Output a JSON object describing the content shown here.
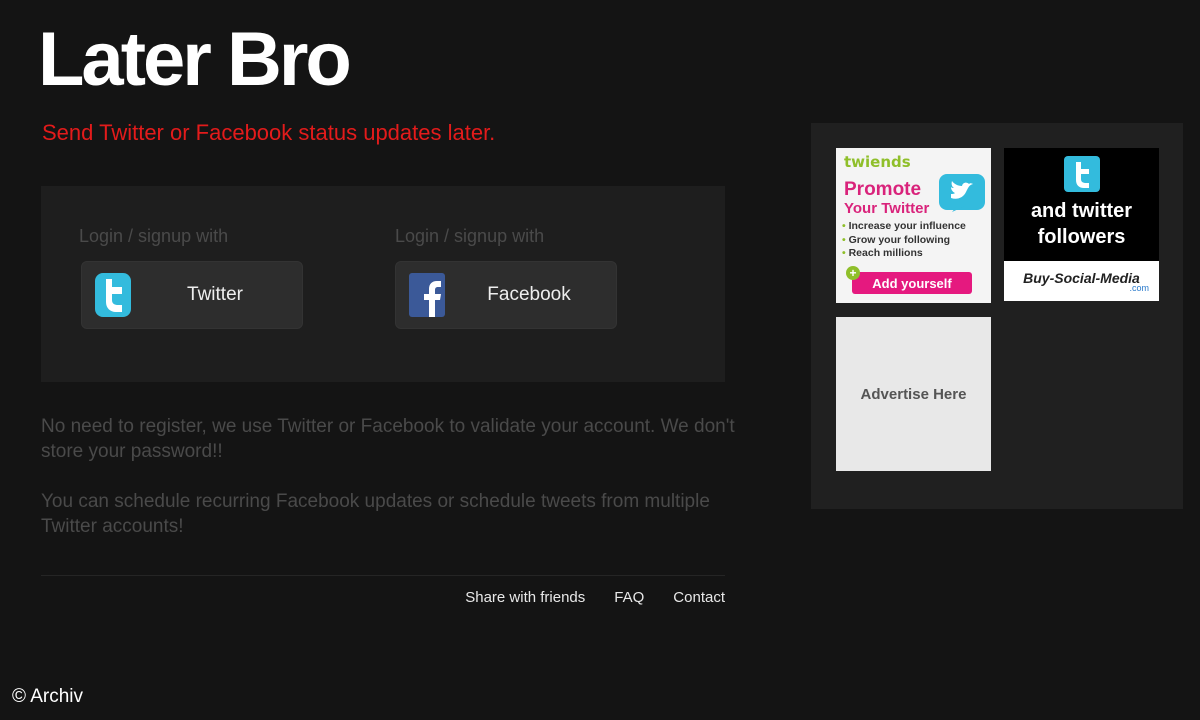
{
  "header": {
    "logo": "Later Bro",
    "tagline": "Send Twitter or Facebook status updates later."
  },
  "login": {
    "twitter": {
      "label": "Login / signup with",
      "button": "Twitter",
      "icon": "twitter-bird-icon"
    },
    "facebook": {
      "label": "Login / signup with",
      "button": "Facebook",
      "icon": "facebook-f-icon"
    }
  },
  "info": {
    "p1": "No need to register, we use Twitter or Facebook to validate your account. We don't store your password!!",
    "p2": "You can schedule recurring Facebook updates or schedule tweets from multiple Twitter accounts!"
  },
  "footer": {
    "links": [
      "Share with friends",
      "FAQ",
      "Contact"
    ]
  },
  "ads": {
    "twiends": {
      "brand": "twiends",
      "headline": "Promote",
      "subheadline": "Your Twitter",
      "bullets": [
        "Increase your influence",
        "Grow your following",
        "Reach millions"
      ],
      "cta": "Add yourself",
      "plus": "+"
    },
    "buy_social": {
      "headline_line1": "and twitter",
      "headline_line2": "followers",
      "brand": "Buy-Social-Media",
      "tld": ".com"
    },
    "placeholder": "Advertise Here"
  },
  "copyright": "© Archiv",
  "colors": {
    "background": "#141414",
    "tagline": "#e31b1b",
    "twitter": "#33bbdd",
    "facebook": "#3b5998"
  }
}
